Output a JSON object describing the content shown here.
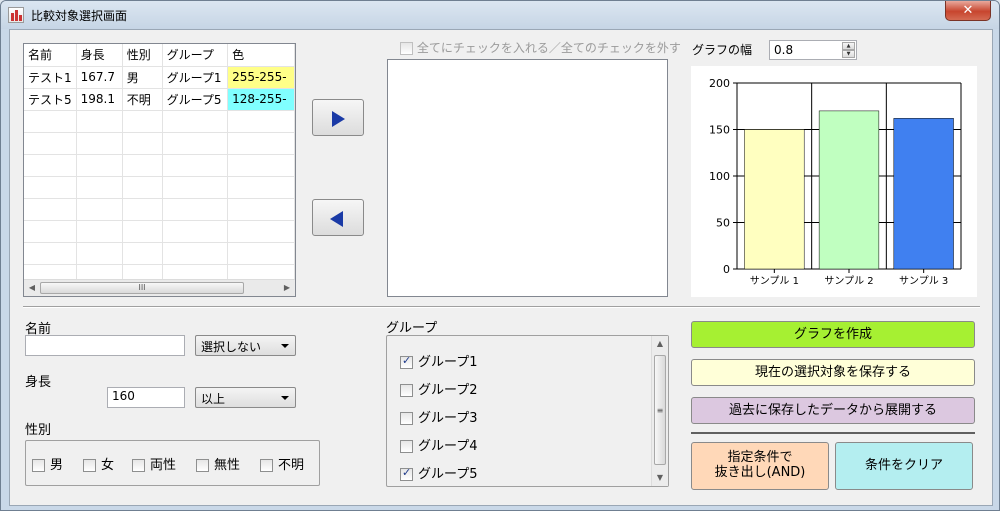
{
  "window": {
    "title": "比較対象選択画面",
    "close_label": "✕"
  },
  "grid": {
    "headers": [
      "名前",
      "身長",
      "性別",
      "グループ",
      "色"
    ],
    "rows": [
      {
        "name": "テスト1",
        "height": "167.7",
        "gender": "男",
        "group": "グループ1",
        "color": "255-255-",
        "color_bg": "#ffff88"
      },
      {
        "name": "テスト5",
        "height": "198.1",
        "gender": "不明",
        "group": "グループ5",
        "color": "128-255-",
        "color_bg": "#80ffff"
      }
    ],
    "hscroll_grip": "III"
  },
  "buttons": {
    "move_right_icon": "right-triangle",
    "move_left_icon": "left-triangle"
  },
  "list": {
    "select_all_label": "全てにチェックを入れる／全てのチェックを外す"
  },
  "chart_controls": {
    "width_label": "グラフの幅",
    "width_value": "0.8"
  },
  "chart_data": {
    "type": "bar",
    "categories": [
      "サンプル 1",
      "サンプル 2",
      "サンプル 3"
    ],
    "values": [
      150,
      170,
      162
    ],
    "colors": [
      "#ffffc0",
      "#c0ffc0",
      "#4080f0"
    ],
    "ylim": [
      0,
      200
    ],
    "yticks": [
      "0",
      "50",
      "100",
      "150",
      "200"
    ],
    "grid": true
  },
  "filters": {
    "name_label": "名前",
    "name_value": "",
    "name_mode": "選択しない",
    "height_label": "身長",
    "height_value": "160",
    "height_mode": "以上",
    "gender_label": "性別",
    "genders": [
      "男",
      "女",
      "両性",
      "無性",
      "不明"
    ]
  },
  "groups": {
    "label": "グループ",
    "items": [
      {
        "label": "グループ1",
        "checked": true
      },
      {
        "label": "グループ2",
        "checked": false
      },
      {
        "label": "グループ3",
        "checked": false
      },
      {
        "label": "グループ4",
        "checked": false
      },
      {
        "label": "グループ5",
        "checked": true
      }
    ],
    "vscroll_grip": "≡"
  },
  "actions": {
    "create_graph": "グラフを作成",
    "save_selection": "現在の選択対象を保存する",
    "load_saved": "過去に保存したデータから展開する",
    "extract_line1": "指定条件で",
    "extract_line2": "抜き出し(AND)",
    "clear": "条件をクリア"
  },
  "colors": {
    "create_graph": "#a6f032",
    "save_selection": "#ffffd8",
    "load_saved": "#dcc8e0",
    "extract": "#ffd8b8",
    "clear": "#b4eef0"
  }
}
